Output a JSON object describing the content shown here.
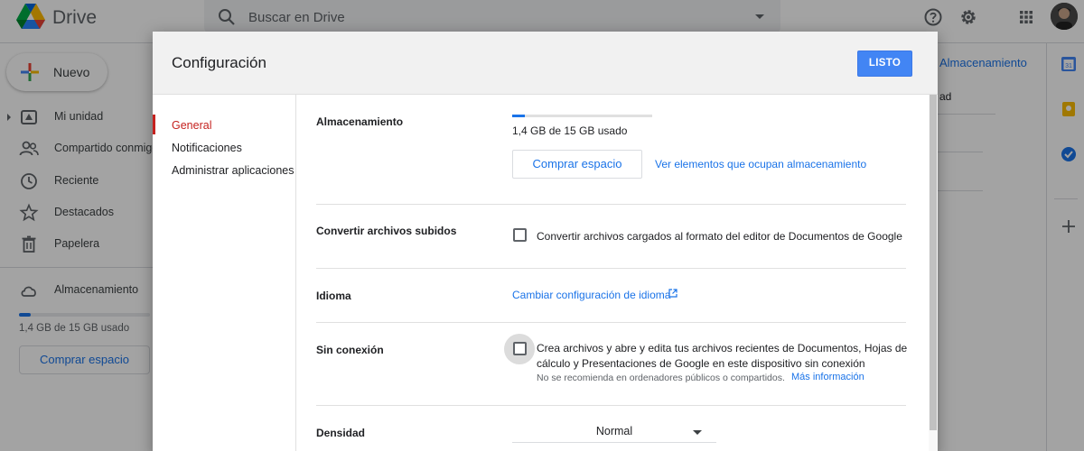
{
  "app": {
    "name": "Drive"
  },
  "search": {
    "placeholder": "Buscar en Drive"
  },
  "sidebar": {
    "new_label": "Nuevo",
    "items": [
      {
        "label": "Mi unidad",
        "icon": "my-drive-icon"
      },
      {
        "label": "Compartido conmigo",
        "icon": "shared-icon"
      },
      {
        "label": "Reciente",
        "icon": "recent-icon"
      },
      {
        "label": "Destacados",
        "icon": "star-icon"
      },
      {
        "label": "Papelera",
        "icon": "trash-icon"
      }
    ],
    "storage_label": "Almacenamiento",
    "storage_used": "1,4 GB de 15 GB usado",
    "storage_fraction": 0.093,
    "buy_label": "Comprar espacio"
  },
  "background_right": {
    "storage_link": "Almacenamiento",
    "partial_text": "ad"
  },
  "colors": {
    "accent": "#1a73e8",
    "primary_button": "#4285f4",
    "active_nav": "#c5221f"
  },
  "dialog": {
    "title": "Configuración",
    "done_label": "LISTO",
    "nav": [
      {
        "label": "General",
        "active": true
      },
      {
        "label": "Notificaciones",
        "active": false
      },
      {
        "label": "Administrar aplicaciones",
        "active": false
      }
    ],
    "storage": {
      "label": "Almacenamiento",
      "used_text": "1,4 GB de 15 GB usado",
      "used_fraction": 0.093,
      "buy_label": "Comprar espacio",
      "view_link": "Ver elementos que ocupan almacenamiento"
    },
    "convert": {
      "label": "Convertir archivos subidos",
      "option_text": "Convertir archivos cargados al formato del editor de Documentos de Google",
      "checked": false
    },
    "language": {
      "label": "Idioma",
      "link": "Cambiar configuración de idioma"
    },
    "offline": {
      "label": "Sin conexión",
      "option_line1": "Crea archivos y abre y edita tus archivos recientes de Documentos, Hojas de",
      "option_line2": "cálculo y Presentaciones de Google en este dispositivo sin conexión",
      "note": "No se recomienda en ordenadores públicos o compartidos.",
      "more_link": "Más información",
      "checked": false
    },
    "density": {
      "label": "Densidad",
      "value": "Normal"
    }
  }
}
